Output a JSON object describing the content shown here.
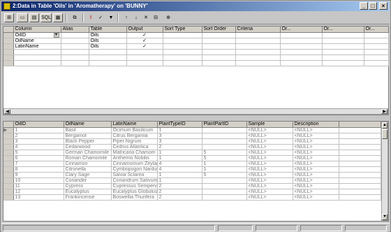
{
  "window": {
    "title": "2:Data in Table 'Oils' in 'Aromatherapy' on 'BUNNY'",
    "minimize": "_",
    "maximize": "□",
    "close": "×"
  },
  "toolbar": {
    "buttons": [
      "tbl-icon",
      "oo-icon",
      "grid-icon",
      "SQL",
      "grid2-icon",
      "copy-icon",
      "!",
      "filter-icon",
      "sort-az-icon",
      "sort-za-icon",
      "remove-filter-icon",
      "tool-icon"
    ]
  },
  "criteria": {
    "headers": [
      "Column",
      "Alias",
      "Table",
      "Output",
      "Sort Type",
      "Sort Order",
      "Criteria",
      "Or...",
      "Or...",
      "Or..."
    ],
    "rows": [
      {
        "column": "OilID",
        "alias": "",
        "table": "Oils",
        "output": "✓"
      },
      {
        "column": "OilName",
        "alias": "",
        "table": "Oils",
        "output": "✓"
      },
      {
        "column": "LatinName",
        "alias": "",
        "table": "Oils",
        "output": "✓"
      },
      {
        "column": "",
        "alias": "",
        "table": "",
        "output": ""
      },
      {
        "column": "",
        "alias": "",
        "table": "",
        "output": ""
      },
      {
        "column": "",
        "alias": "",
        "table": "",
        "output": ""
      }
    ]
  },
  "results": {
    "headers": [
      "OilID",
      "OilName",
      "LatinName",
      "PlantTypeID",
      "PlantPartID",
      "Sample",
      "Description"
    ],
    "rows": [
      [
        "1",
        "Basil",
        "Ocimum Basilicum",
        "1",
        "",
        "<NULL>",
        "<NULL>"
      ],
      [
        "2",
        "Bergamot",
        "Citrus Bergamia",
        "3",
        "",
        "<NULL>",
        "<NULL>"
      ],
      [
        "3",
        "Black Pepper",
        "Piper Nigrum",
        "3",
        "",
        "<NULL>",
        "<NULL>"
      ],
      [
        "4",
        "Cedarwood",
        "Cedrus Atlantica",
        "2",
        "",
        "<NULL>",
        "<NULL>"
      ],
      [
        "5",
        "German Chamomile",
        "Matricaria Chamom",
        "1",
        "5",
        "<NULL>",
        "<NULL>"
      ],
      [
        "6",
        "Roman Chamomile",
        "Anthemis Nobilis",
        "1",
        "5",
        "<NULL>",
        "<NULL>"
      ],
      [
        "7",
        "Cinnamon",
        "Cinnamomum Zeylani",
        "4",
        "1",
        "<NULL>",
        "<NULL>"
      ],
      [
        "8",
        "Citronella",
        "Cymbopogon Nardus",
        "4",
        "1",
        "<NULL>",
        "<NULL>"
      ],
      [
        "9",
        "Clary Sage",
        "Salvia Sclarea",
        "1",
        "5",
        "<NULL>",
        "<NULL>"
      ],
      [
        "10",
        "Coriander",
        "Coriandrum Sativum",
        "1",
        "",
        "<NULL>",
        "<NULL>"
      ],
      [
        "11",
        "Cypress",
        "Cupressus Sempervir",
        "2",
        "",
        "<NULL>",
        "<NULL>"
      ],
      [
        "12",
        "Eucalyptus",
        "Eucalyptus Globulus",
        "2",
        "",
        "<NULL>",
        "<NULL>"
      ],
      [
        "13",
        "Frankincense",
        "Boswellia Thurifera",
        "2",
        "",
        "<NULL>",
        "<NULL>"
      ]
    ]
  }
}
